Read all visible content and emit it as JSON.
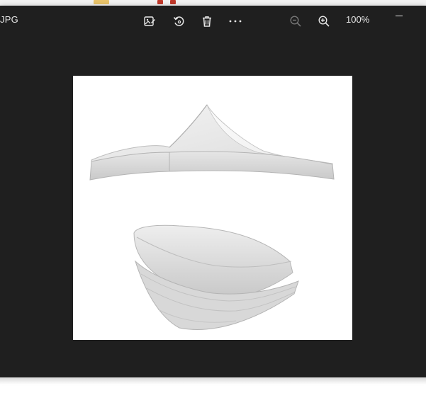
{
  "titlebar": {
    "file_type": "JPG",
    "zoom_level": "100%"
  },
  "icons": {
    "edit": "edit-image-icon",
    "rotate": "rotate-icon",
    "delete": "trash-icon",
    "more": "more-options-icon",
    "zoom_out": "zoom-out-icon",
    "zoom_in": "zoom-in-icon",
    "minimize": "minimize-icon"
  },
  "colors": {
    "window_bg": "#1f1f1f",
    "icon": "#e9e9e9",
    "icon_disabled": "#777777",
    "photo_bg": "#ffffff"
  }
}
